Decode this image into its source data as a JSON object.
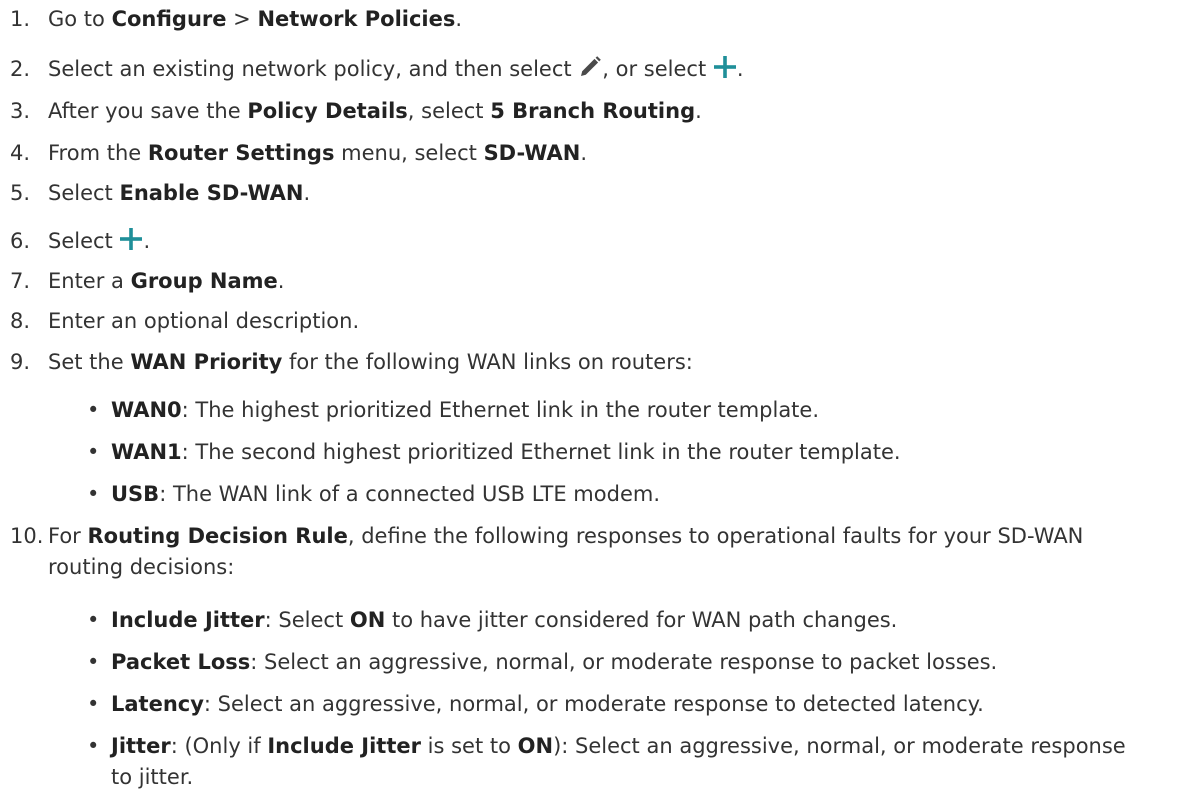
{
  "steps": [
    {
      "num": "1.",
      "parts": [
        "Go to ",
        "Configure",
        " > ",
        "Network Policies",
        "."
      ]
    },
    {
      "num": "2.",
      "parts": [
        "Select an existing network policy, and then select ",
        ", or select ",
        "."
      ],
      "icons": [
        "pencil-icon",
        "plus-icon"
      ]
    },
    {
      "num": "3.",
      "parts": [
        "After you save the ",
        "Policy Details",
        ", select ",
        "5 Branch Routing",
        "."
      ]
    },
    {
      "num": "4.",
      "parts": [
        "From the ",
        "Router Settings",
        " menu, select ",
        "SD-WAN",
        "."
      ]
    },
    {
      "num": "5.",
      "parts": [
        "Select ",
        "Enable SD-WAN",
        "."
      ]
    },
    {
      "num": "6.",
      "parts": [
        "Select ",
        "."
      ],
      "icons": [
        "plus-icon"
      ]
    },
    {
      "num": "7.",
      "parts": [
        "Enter a ",
        "Group Name",
        "."
      ]
    },
    {
      "num": "8.",
      "parts": [
        "Enter an optional description."
      ]
    },
    {
      "num": "9.",
      "parts": [
        "Set the ",
        "WAN Priority",
        " for the following WAN links on routers:"
      ]
    },
    {
      "num": "10.",
      "parts": [
        "For ",
        "Routing Decision Rule",
        ", define the following responses to operational faults for your SD-WAN routing decisions:"
      ]
    }
  ],
  "wan_bullets": [
    {
      "label": "WAN0",
      "text": ": The highest prioritized Ethernet link in the router template."
    },
    {
      "label": "WAN1",
      "text": ": The second highest prioritized Ethernet link in the router template."
    },
    {
      "label": "USB",
      "text": ": The WAN link of a connected USB LTE modem."
    }
  ],
  "rule_bullets": [
    {
      "parts": [
        "Include Jitter",
        ": Select ",
        "ON",
        " to have jitter considered for WAN path changes."
      ]
    },
    {
      "parts": [
        "Packet Loss",
        ": Select an aggressive, normal, or moderate response to packet losses."
      ]
    },
    {
      "parts": [
        "Latency",
        ": Select an aggressive, normal, or moderate response to detected latency."
      ]
    },
    {
      "parts": [
        "Jitter",
        ": (Only if ",
        "Include Jitter",
        " is set to ",
        "ON",
        "): Select an aggressive, normal, or moderate response to jitter."
      ]
    }
  ],
  "bullet_char": "•",
  "colors": {
    "text": "#333333",
    "icon_teal": "#1f8f99",
    "pencil": "#4a4a4a"
  }
}
